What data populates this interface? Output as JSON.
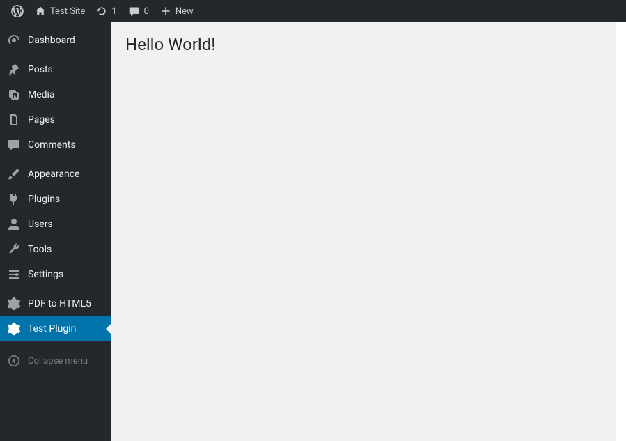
{
  "adminbar": {
    "site_name": "Test Site",
    "updates_count": "1",
    "comments_count": "0",
    "new_label": "New"
  },
  "sidebar": {
    "items": [
      {
        "label": "Dashboard"
      },
      {
        "label": "Posts"
      },
      {
        "label": "Media"
      },
      {
        "label": "Pages"
      },
      {
        "label": "Comments"
      },
      {
        "label": "Appearance"
      },
      {
        "label": "Plugins"
      },
      {
        "label": "Users"
      },
      {
        "label": "Tools"
      },
      {
        "label": "Settings"
      },
      {
        "label": "PDF to HTML5"
      },
      {
        "label": "Test Plugin"
      }
    ],
    "collapse_label": "Collapse menu"
  },
  "content": {
    "heading": "Hello World!"
  }
}
